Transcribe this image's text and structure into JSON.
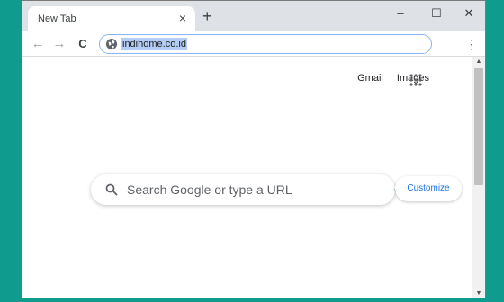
{
  "browser": {
    "tab": {
      "title": "New Tab",
      "close_symbol": "×"
    },
    "new_tab_symbol": "+",
    "window_controls": {
      "minimize": "–",
      "maximize": "☐",
      "close": "✕"
    },
    "nav": {
      "back": "←",
      "forward": "→",
      "reload": "C"
    },
    "address_bar": {
      "url": "indihome.co.id"
    },
    "menu_symbol": "⋮"
  },
  "page": {
    "links": {
      "gmail": "Gmail",
      "images": "Images"
    },
    "search": {
      "placeholder": "Search Google or type a URL"
    },
    "customize_label": "Customize"
  },
  "scrollbar": {
    "up_symbol": "▲",
    "down_symbol": "▼"
  },
  "colors": {
    "accent": "#1a73e8",
    "frame": "#dee1e6",
    "outer_background": "#0f9b8e",
    "selection": "#b4cdf5"
  }
}
